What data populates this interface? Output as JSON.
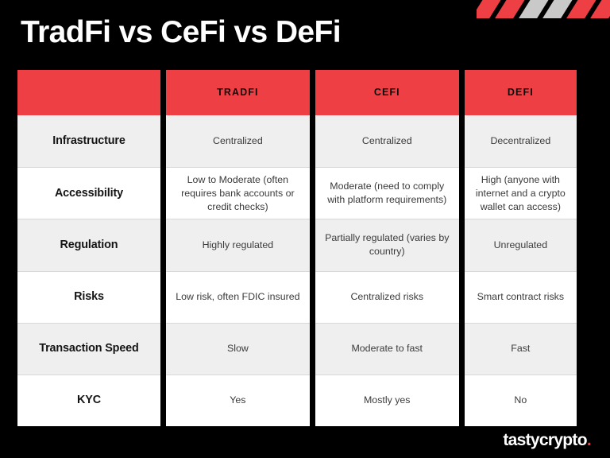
{
  "slide": {
    "title": "TradFi vs CeFi vs DeFi",
    "background_color": "#000000",
    "accent_color": "#EE4044",
    "header_text_color": "#0D0D0D",
    "shade_row_color": "#EFEFEF",
    "plain_row_color": "#FFFFFF",
    "body_text_color": "#3B3B3B"
  },
  "decor": {
    "corner_stripes_name": "diagonal-stripe-pattern",
    "stripe_colors": [
      "#EE4044",
      "#EE4044",
      "#C9C9C9",
      "#C9C9C9",
      "#EE4044",
      "#EE4044"
    ]
  },
  "table": {
    "headers": [
      "",
      "TRADFI",
      "CEFI",
      "DEFI"
    ],
    "rows": [
      {
        "label": "Infrastructure",
        "shaded": true,
        "cells": [
          "Centralized",
          "Centralized",
          "Decentralized"
        ]
      },
      {
        "label": "Accessibility",
        "shaded": false,
        "cells": [
          "Low to Moderate (often requires bank accounts or credit checks)",
          "Moderate (need to comply with platform requirements)",
          "High (anyone with internet and a crypto wallet can access)"
        ]
      },
      {
        "label": "Regulation",
        "shaded": true,
        "cells": [
          "Highly regulated",
          "Partially regulated (varies by country)",
          "Unregulated"
        ]
      },
      {
        "label": "Risks",
        "shaded": false,
        "cells": [
          "Low risk, often FDIC insured",
          "Centralized risks",
          "Smart contract risks"
        ]
      },
      {
        "label": "Transaction Speed",
        "shaded": true,
        "cells": [
          "Slow",
          "Moderate to fast",
          "Fast"
        ]
      },
      {
        "label": "KYC",
        "shaded": false,
        "cells": [
          "Yes",
          "Mostly yes",
          "No"
        ]
      }
    ]
  },
  "footer": {
    "logo_text": "tastycrypto",
    "logo_dot": ".",
    "logo_dot_color": "#EE4044"
  }
}
